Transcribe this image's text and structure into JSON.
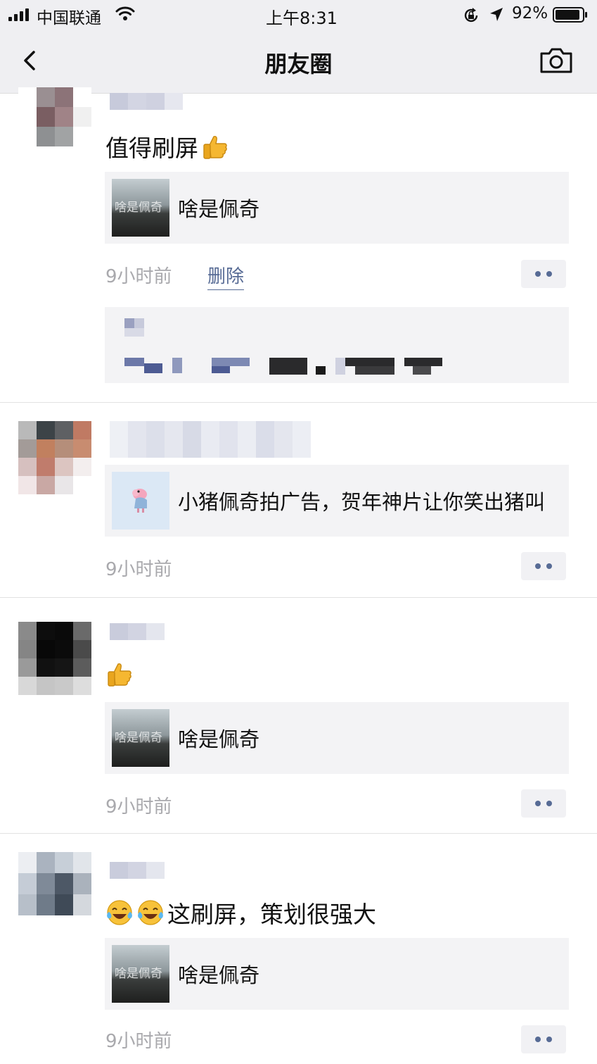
{
  "status_bar": {
    "carrier": "中国联通",
    "time": "上午8:31",
    "battery_percent": "92%",
    "battery_level": 0.92,
    "icons": [
      "signal-icon",
      "wifi-icon",
      "orientation-lock-icon",
      "location-icon",
      "battery-icon"
    ]
  },
  "nav": {
    "title": "朋友圈",
    "back_icon": "chevron-left-icon",
    "camera_icon": "camera-icon"
  },
  "posts": [
    {
      "text": "值得刷屏",
      "emojis": [
        "thumbs-up"
      ],
      "link": {
        "title": "啥是佩奇",
        "thumb_caption": "啥是佩奇"
      },
      "time": "9小时前",
      "delete_label": "删除",
      "has_comments": true
    },
    {
      "text": "",
      "emojis": [],
      "link": {
        "title": "小猪佩奇拍广告，贺年神片让你笑出猪叫",
        "thumb_caption": ""
      },
      "time": "9小时前"
    },
    {
      "text": "",
      "emojis": [
        "thumbs-up"
      ],
      "link": {
        "title": "啥是佩奇",
        "thumb_caption": "啥是佩奇"
      },
      "time": "9小时前"
    },
    {
      "text": "这刷屏，策划很强大",
      "emojis": [
        "tears-of-joy",
        "tears-of-joy"
      ],
      "link": {
        "title": "啥是佩奇",
        "thumb_caption": "啥是佩奇"
      },
      "time": "9小时前"
    }
  ],
  "colors": {
    "bar_bg": "#efeff2",
    "link_blue": "#576b95",
    "timestamp_gray": "#a9a9ad",
    "card_bg": "#f3f3f5"
  }
}
